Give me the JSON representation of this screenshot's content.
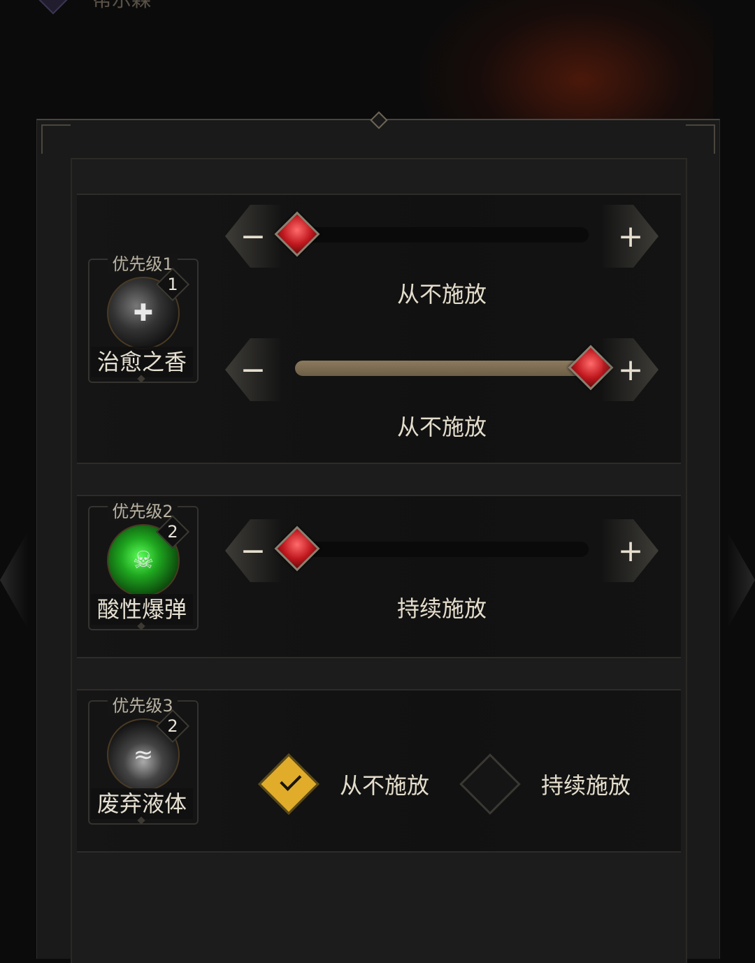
{
  "header": {
    "title": "帮示森"
  },
  "skills": [
    {
      "priority": "优先级1",
      "level": "1",
      "name": "治愈之香",
      "icon": "healing-incense-icon",
      "sliders": [
        {
          "value": 0.0,
          "state": "从不施放"
        },
        {
          "value": 1.0,
          "state": "从不施放"
        }
      ]
    },
    {
      "priority": "优先级2",
      "level": "2",
      "name": "酸性爆弹",
      "icon": "acid-bomb-icon",
      "sliders": [
        {
          "value": 0.0,
          "state": "持续施放"
        }
      ]
    },
    {
      "priority": "优先级3",
      "level": "2",
      "name": "废弃液体",
      "icon": "waste-liquid-icon",
      "options": [
        {
          "label": "从不施放",
          "selected": true
        },
        {
          "label": "持续施放",
          "selected": false
        }
      ]
    }
  ],
  "controls": {
    "minus": "−",
    "plus": "+"
  },
  "colors": {
    "accent_gold": "#e0ac2a",
    "thumb_red": "#c0181e",
    "fill_tan": "#8c7a5e"
  }
}
